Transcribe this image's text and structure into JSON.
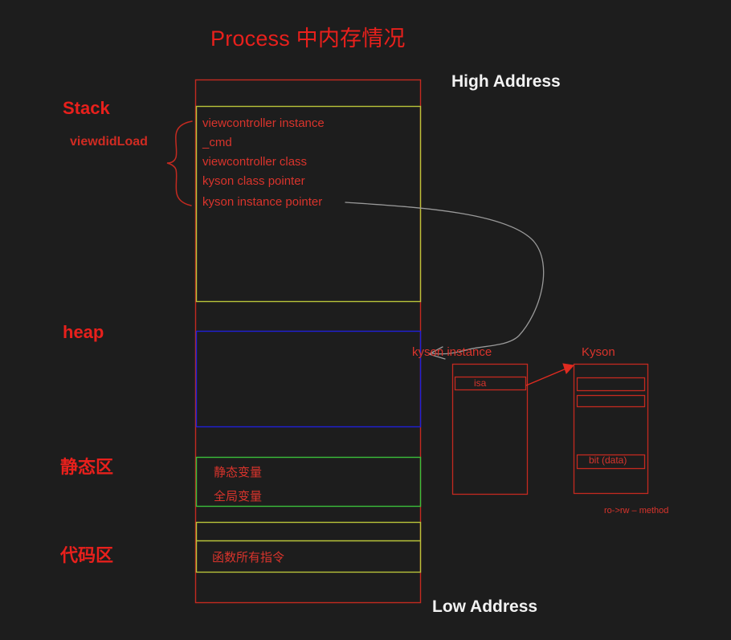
{
  "title": "Process 中内存情况",
  "colors": {
    "background": "#1d1d1d",
    "title_red": "#e8201c",
    "text_red": "#d9342c",
    "label_red": "#e8201c",
    "outer_box": "#c42a20",
    "stack_box": "#b9c43a",
    "heap_box": "#2020d8",
    "static_box": "#3bbf3b",
    "code_box": "#b9c43a",
    "white_text": "#f2f2f2",
    "pointer_arrow": "#9a9a9a",
    "isa_arrow": "#e02b20"
  },
  "addresses": {
    "high": "High Address",
    "low": "Low Address"
  },
  "regions": [
    {
      "name": "stack",
      "label": "Stack"
    },
    {
      "name": "frame",
      "label": "viewdidLoad"
    },
    {
      "name": "heap",
      "label": "heap"
    },
    {
      "name": "static",
      "label": "静态区"
    },
    {
      "name": "code",
      "label": "代码区"
    }
  ],
  "stack_frame": {
    "lines": [
      "viewcontroller instance",
      "_cmd",
      "viewcontroller class",
      "kyson class pointer",
      "kyson instance pointer"
    ]
  },
  "static_area": {
    "lines": [
      "静态变量",
      "全局变量"
    ]
  },
  "code_area": {
    "lines": [
      "函数所有指令"
    ]
  },
  "objects": {
    "instance": {
      "label": "kyson instance",
      "slots": [
        "isa"
      ]
    },
    "klass": {
      "label": "Kyson",
      "slots": [
        "",
        "",
        "bit (data)"
      ],
      "footnote": "ro->rw – method"
    }
  }
}
